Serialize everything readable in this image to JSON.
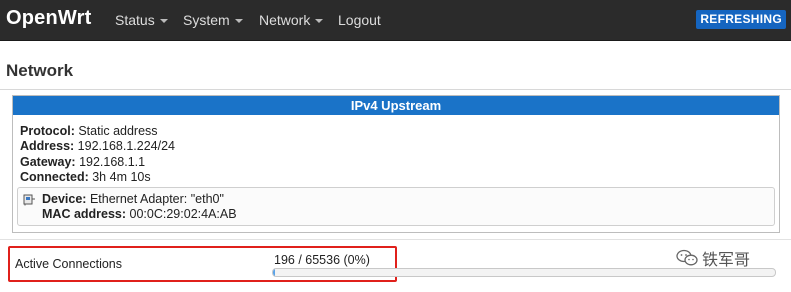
{
  "navbar": {
    "brand": "OpenWrt",
    "menu": [
      {
        "label": "Status",
        "dropdown": true
      },
      {
        "label": "System",
        "dropdown": true
      },
      {
        "label": "Network",
        "dropdown": true
      },
      {
        "label": "Logout",
        "dropdown": false
      }
    ],
    "status_badge": "REFRESHING"
  },
  "page": {
    "title": "Network"
  },
  "upstream": {
    "header": "IPv4 Upstream",
    "protocol_label": "Protocol:",
    "protocol_value": "Static address",
    "address_label": "Address:",
    "address_value": "192.168.1.224/24",
    "gateway_label": "Gateway:",
    "gateway_value": "192.168.1.1",
    "connected_label": "Connected:",
    "connected_value": "3h 4m 10s",
    "device": {
      "icon": "ethernet-port-icon",
      "device_label": "Device:",
      "device_value": "Ethernet Adapter: \"eth0\"",
      "mac_label": "MAC address:",
      "mac_value": "00:0C:29:02:4A:AB"
    }
  },
  "connections": {
    "label": "Active Connections",
    "value_text": "196 / 65536 (0%)",
    "used": 196,
    "max": 65536,
    "fill_fraction": 0.003
  },
  "watermark": {
    "icon": "wechat-icon",
    "text": "铁军哥"
  },
  "colors": {
    "navbar_bg": "#2b2b2b",
    "accent": "#1a73c8",
    "badge": "#1565c0",
    "highlight": "#e0201b"
  }
}
